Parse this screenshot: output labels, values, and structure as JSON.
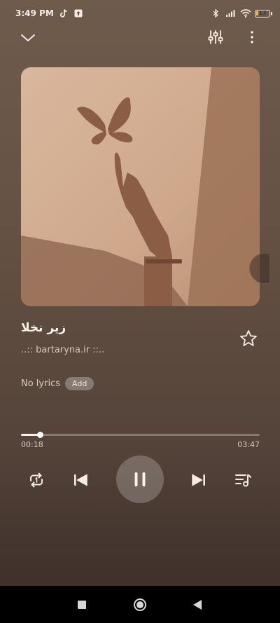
{
  "status_bar": {
    "time": "3:49 PM",
    "battery_level": "17",
    "battery_color": "#f0c342",
    "icons": [
      "tiktok-icon",
      "upload-notification-icon",
      "bluetooth-icon",
      "signal-icon",
      "wifi-icon",
      "battery-icon"
    ]
  },
  "top_bar": {
    "icons": [
      "chevron-down-icon",
      "equalizer-icon",
      "more-vertical-icon"
    ]
  },
  "song": {
    "title": "زیر نخلا",
    "artist": "..:: bartaryna.ir ::.."
  },
  "lyrics": {
    "label": "No lyrics",
    "add_label": "Add"
  },
  "playback": {
    "elapsed": "00:18",
    "total": "03:47",
    "progress_fraction": 0.0793,
    "state": "playing"
  },
  "controls": {
    "icons": [
      "repeat-one-icon",
      "previous-track-icon",
      "pause-icon",
      "next-track-icon",
      "queue-icon"
    ]
  },
  "nav_bar": {
    "icons": [
      "recents-square-icon",
      "home-circle-icon",
      "back-triangle-icon"
    ]
  }
}
